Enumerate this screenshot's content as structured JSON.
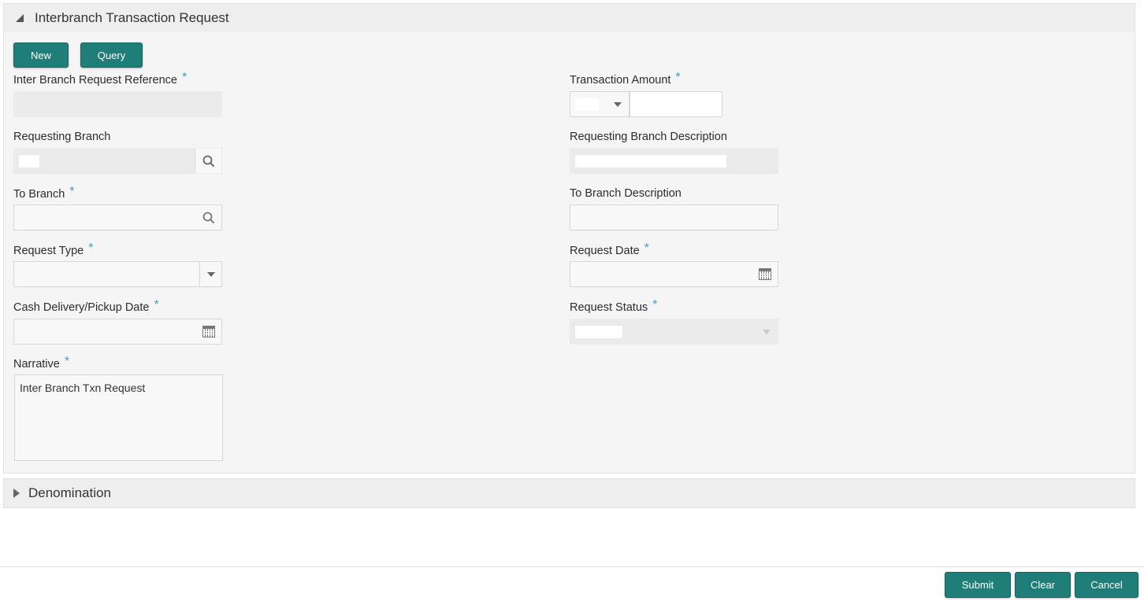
{
  "main_panel": {
    "title": "Interbranch Transaction Request",
    "actions": {
      "new_label": "New",
      "query_label": "Query"
    },
    "fields": {
      "inter_branch_request_reference": {
        "label": "Inter Branch Request Reference",
        "required": "*",
        "value": ""
      },
      "transaction_amount": {
        "label": "Transaction Amount",
        "required": "*",
        "currency": "",
        "amount": ""
      },
      "requesting_branch": {
        "label": "Requesting Branch",
        "value": ""
      },
      "requesting_branch_description": {
        "label": "Requesting Branch Description",
        "value": ""
      },
      "to_branch": {
        "label": "To Branch",
        "required": "*",
        "value": ""
      },
      "to_branch_description": {
        "label": "To Branch Description",
        "value": ""
      },
      "request_type": {
        "label": "Request Type",
        "required": "*",
        "value": ""
      },
      "request_date": {
        "label": "Request Date",
        "required": "*",
        "value": ""
      },
      "cash_delivery_pickup_date": {
        "label": "Cash Delivery/Pickup Date",
        "required": "*",
        "value": ""
      },
      "request_status": {
        "label": "Request Status",
        "required": "*",
        "value": ""
      },
      "narrative": {
        "label": "Narrative",
        "required": "*",
        "value": "Inter Branch Txn Request"
      }
    }
  },
  "denomination_panel": {
    "title": "Denomination"
  },
  "footer": {
    "submit_label": "Submit",
    "clear_label": "Clear",
    "cancel_label": "Cancel"
  },
  "colors": {
    "primary_button": "#1f7e78",
    "required_asterisk": "#3ba0d8",
    "panel_background": "#f5f5f5",
    "header_background": "#eeeeee"
  }
}
